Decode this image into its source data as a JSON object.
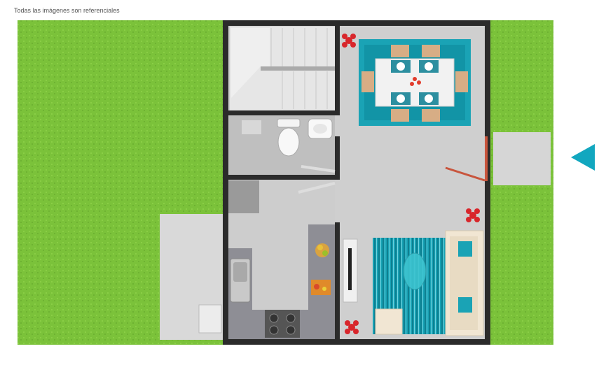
{
  "caption": "Todas las imágenes son referenciales",
  "colors": {
    "grass": "#7bc23a",
    "wall": "#2b2b2b",
    "floor": "#cfcfcf",
    "rug_teal": "#1aa3b5",
    "entrance_arrow": "#12a7bf",
    "door_red": "#c8553d"
  },
  "icons": [
    "entrance-arrow-icon",
    "plant-icon",
    "toilet-icon",
    "sink-icon",
    "stove-icon"
  ]
}
